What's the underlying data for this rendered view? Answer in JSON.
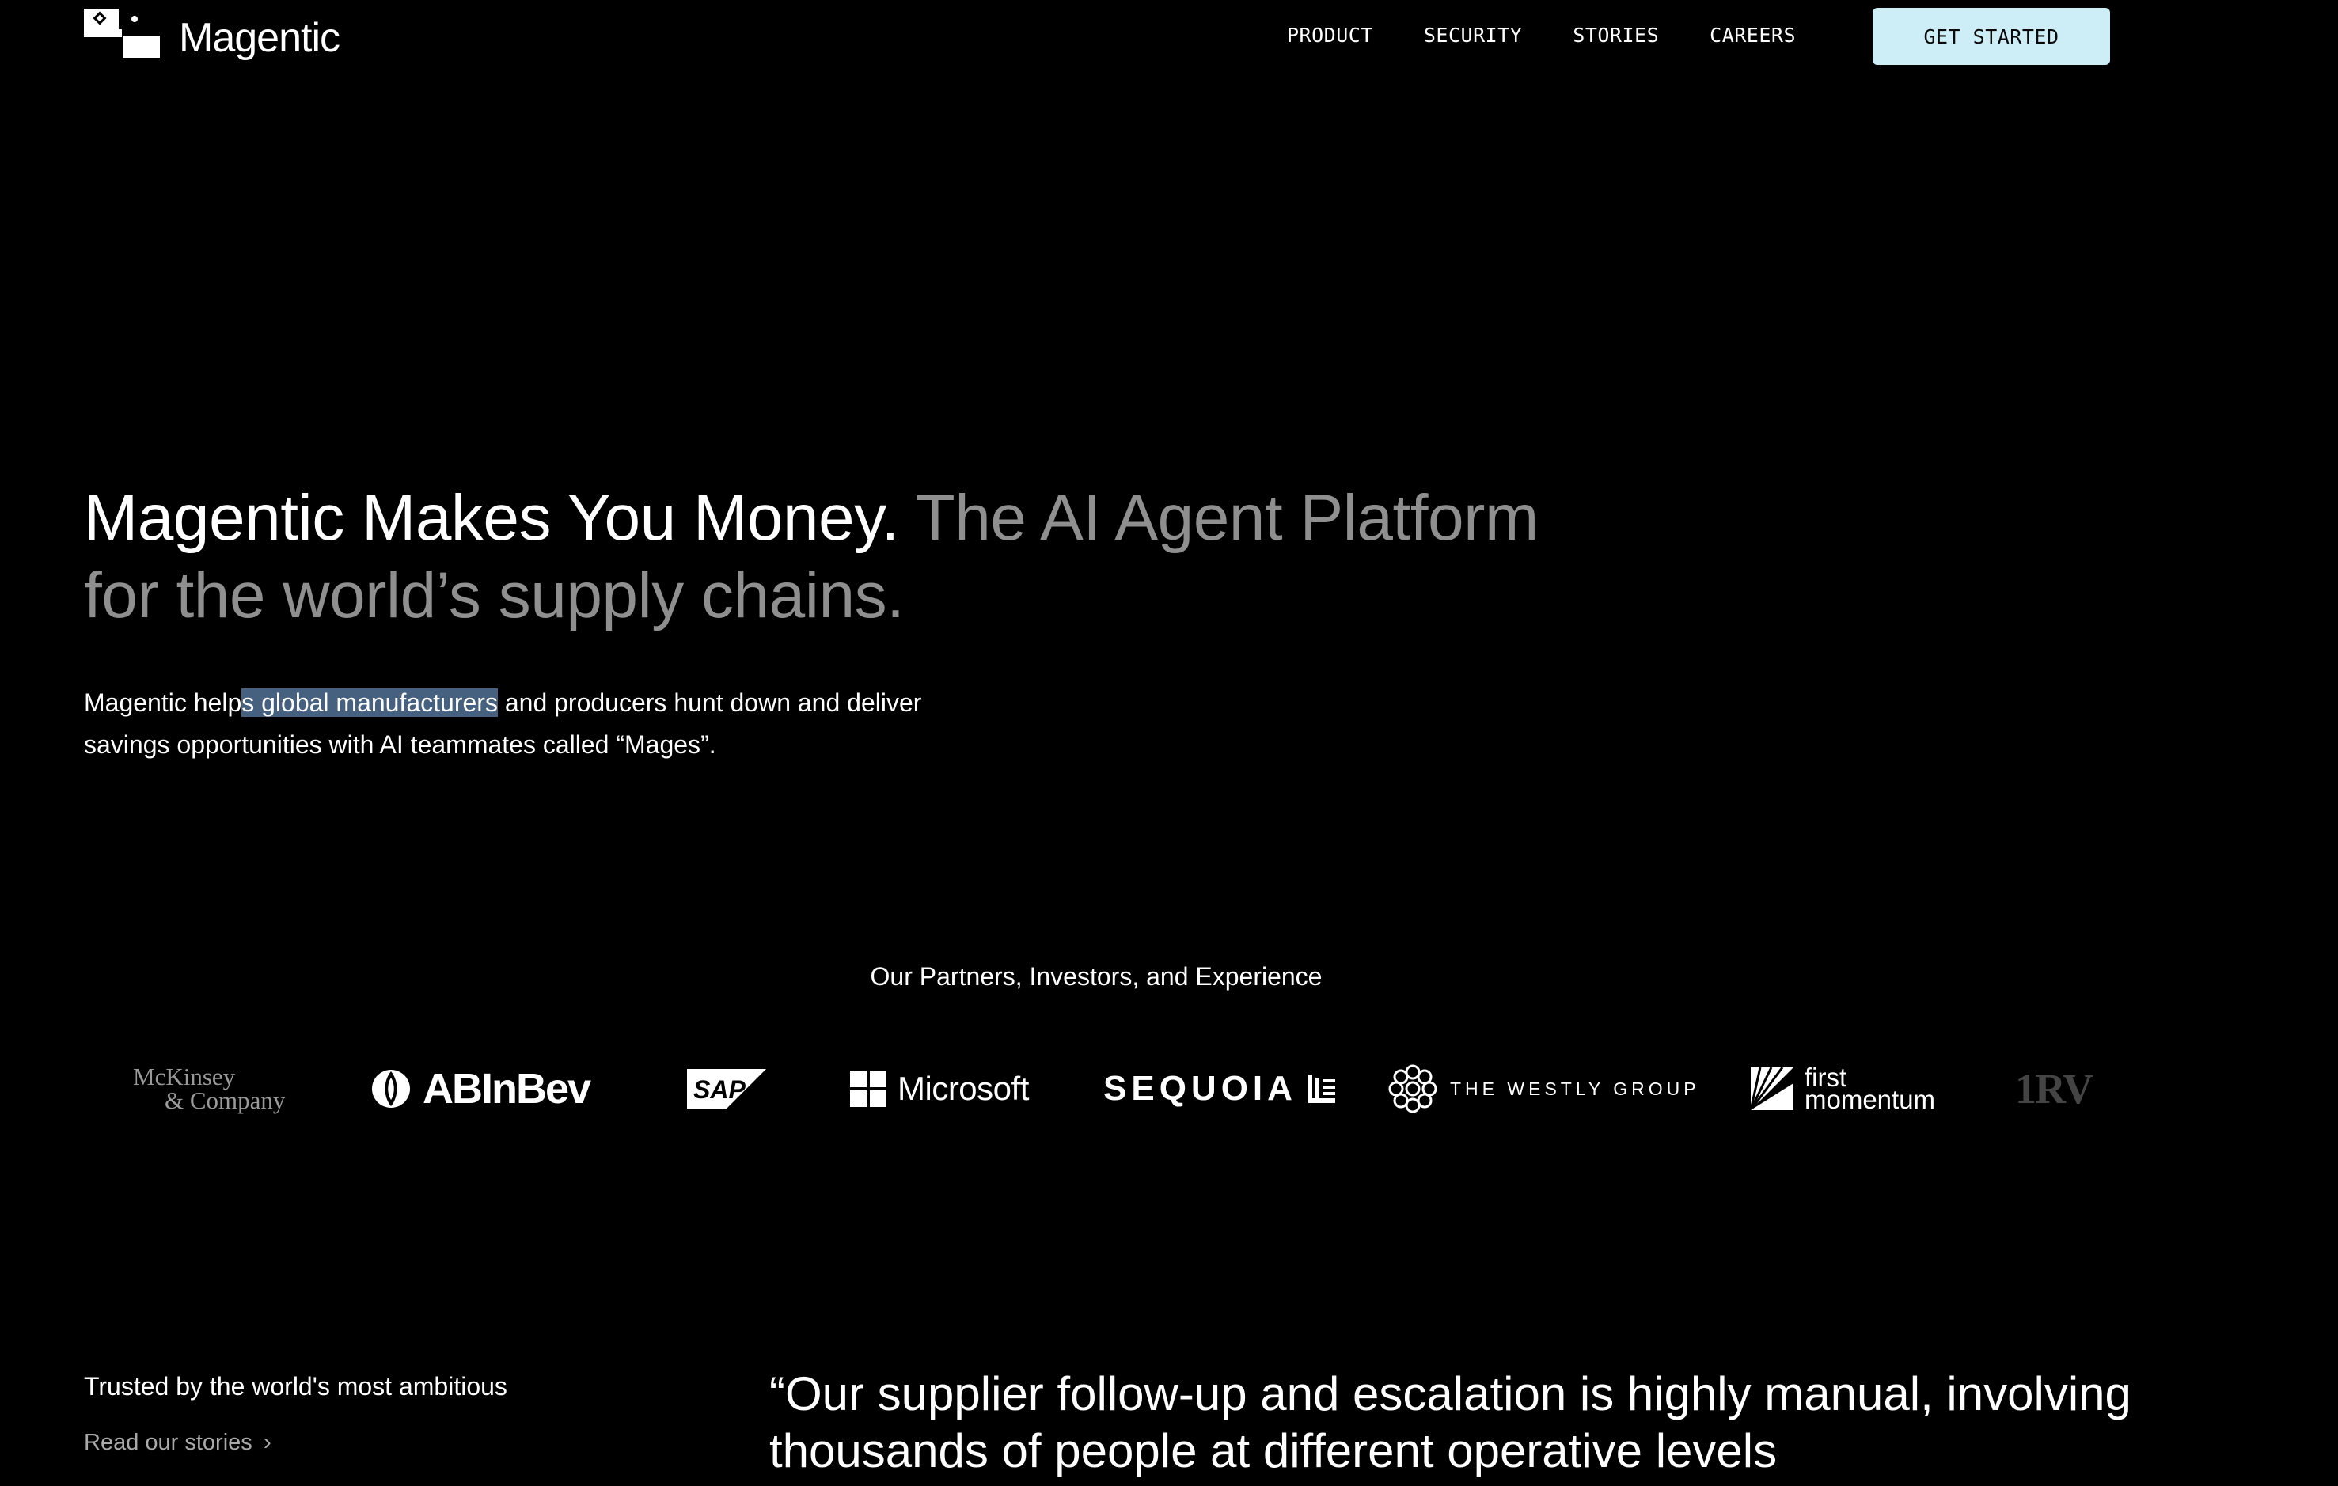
{
  "header": {
    "brand": "Magentic",
    "nav": [
      "PRODUCT",
      "SECURITY",
      "STORIES",
      "CAREERS"
    ],
    "cta": "GET STARTED"
  },
  "hero": {
    "title_main": "Magentic Makes You Money.",
    "title_muted": "The AI Agent Platform for the world’s supply chains.",
    "sub_before": "Magentic help",
    "sub_highlight": "s global manufacturers",
    "sub_after": " and producers hunt down and deliver savings opportunities with AI teammates called “Mages”."
  },
  "partners": {
    "title": "Our Partners, Investors, and Experience",
    "logos": {
      "mckinsey_line1": "McKinsey",
      "mckinsey_line2": "& Company",
      "abinbev": "ABInBev",
      "sap": "SAP",
      "microsoft": "Microsoft",
      "sequoia": "SEQUOIA",
      "westly": "THE WESTLY GROUP",
      "first_line1": "first",
      "first_line2": "momentum",
      "rv": "1RV"
    }
  },
  "bottom": {
    "trusted": "Trusted by the world's most ambitious",
    "read_stories": "Read our stories",
    "quote": "“Our supplier follow-up and escalation is highly manual, involving thousands of people at different operative levels"
  },
  "colors": {
    "background": "#000000",
    "cta_bg": "#cdeef6",
    "highlight": "#46617f",
    "muted_text": "#8f8f8f"
  }
}
